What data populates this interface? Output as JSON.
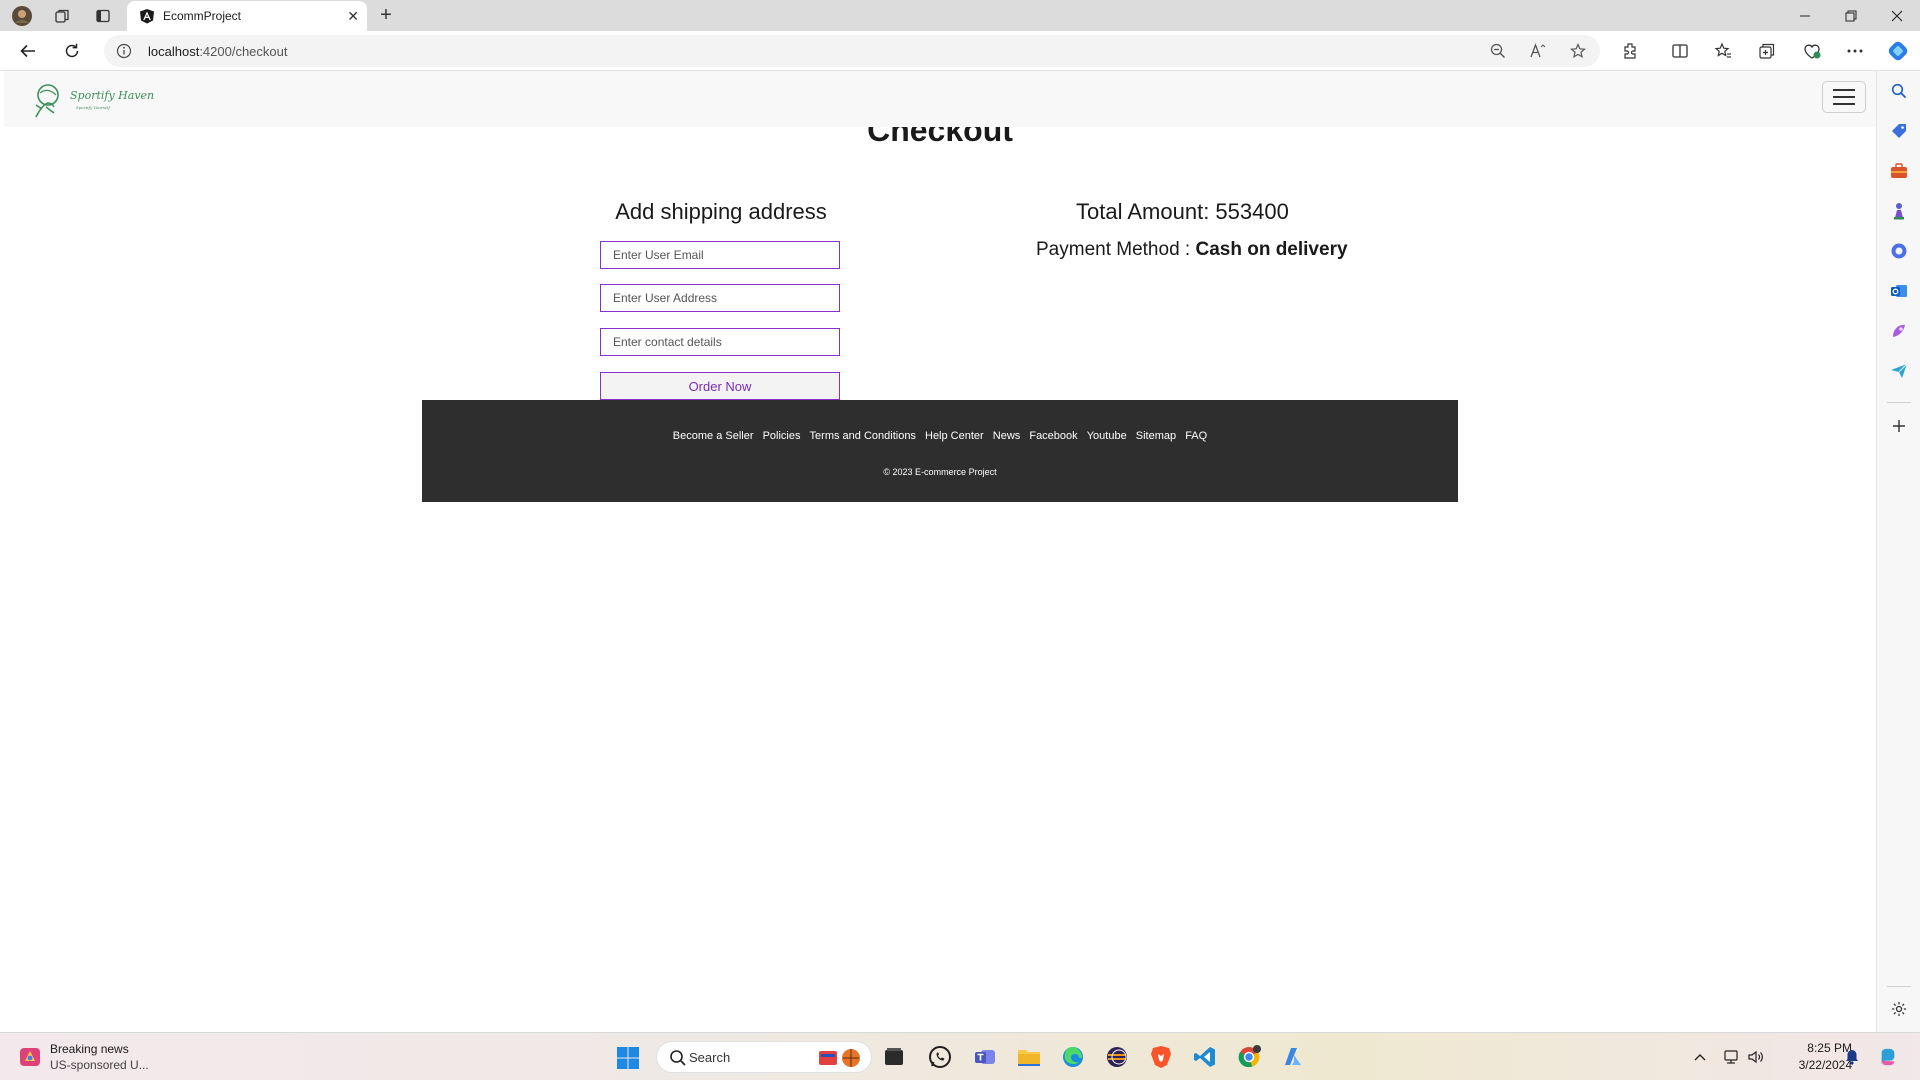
{
  "browser": {
    "tab_title": "EcommProject",
    "url_host": "localhost",
    "url_rest": ":4200/checkout",
    "new_tab_label": "+"
  },
  "page": {
    "title": "Checkout",
    "shipping": {
      "heading": "Add shipping address",
      "email_placeholder": "Enter User Email",
      "address_placeholder": "Enter User Address",
      "contact_placeholder": "Enter contact details",
      "email_value": "",
      "address_value": "",
      "contact_value": "",
      "order_button": "Order Now"
    },
    "summary": {
      "total_label": "Total Amount: 553400",
      "payment_label": "Payment Method : ",
      "payment_value": "Cash on delivery"
    },
    "logo_text": "Sportify Haven",
    "logo_tagline": "Sportify Yourself"
  },
  "footer": {
    "links": [
      "Become a Seller",
      "Policies",
      "Terms and Conditions",
      "Help Center",
      "News",
      "Facebook",
      "Youtube",
      "Sitemap",
      "FAQ"
    ],
    "copyright": "© 2023 E-commerce Project"
  },
  "taskbar": {
    "news_title": "Breaking news",
    "news_subtitle": "US-sponsored U...",
    "search_placeholder": "Search",
    "time": "8:25 PM",
    "date": "3/22/2024"
  },
  "colors": {
    "accent_purple": "#8b2fc9",
    "footer_bg": "#2e2e2e",
    "logo_green": "#3c8f5a"
  }
}
